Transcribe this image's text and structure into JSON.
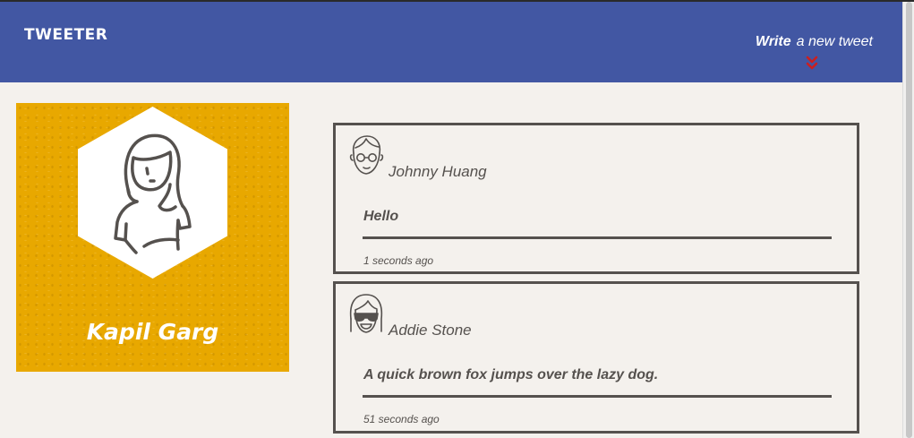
{
  "colors": {
    "nav_bg": "#4257a3",
    "page_bg": "#f4f1ed",
    "profile_bg": "#e8a800",
    "ink": "#55514e",
    "accent": "#cc1f1f"
  },
  "header": {
    "brand": "TWEETER",
    "compose_strong": "Write",
    "compose_light": "a new tweet",
    "compose_icon": "double-chevron-down-icon"
  },
  "profile": {
    "name": "Kapil Garg",
    "avatar_icon": "woman-avatar-icon"
  },
  "tweets": [
    {
      "author": "Johnny Huang",
      "avatar_icon": "man-glasses-avatar-icon",
      "content": "Hello",
      "time": "1 seconds ago"
    },
    {
      "author": "Addie Stone",
      "avatar_icon": "sunglasses-avatar-icon",
      "content": "A quick brown fox jumps over the lazy dog.",
      "time": "51 seconds ago"
    }
  ]
}
